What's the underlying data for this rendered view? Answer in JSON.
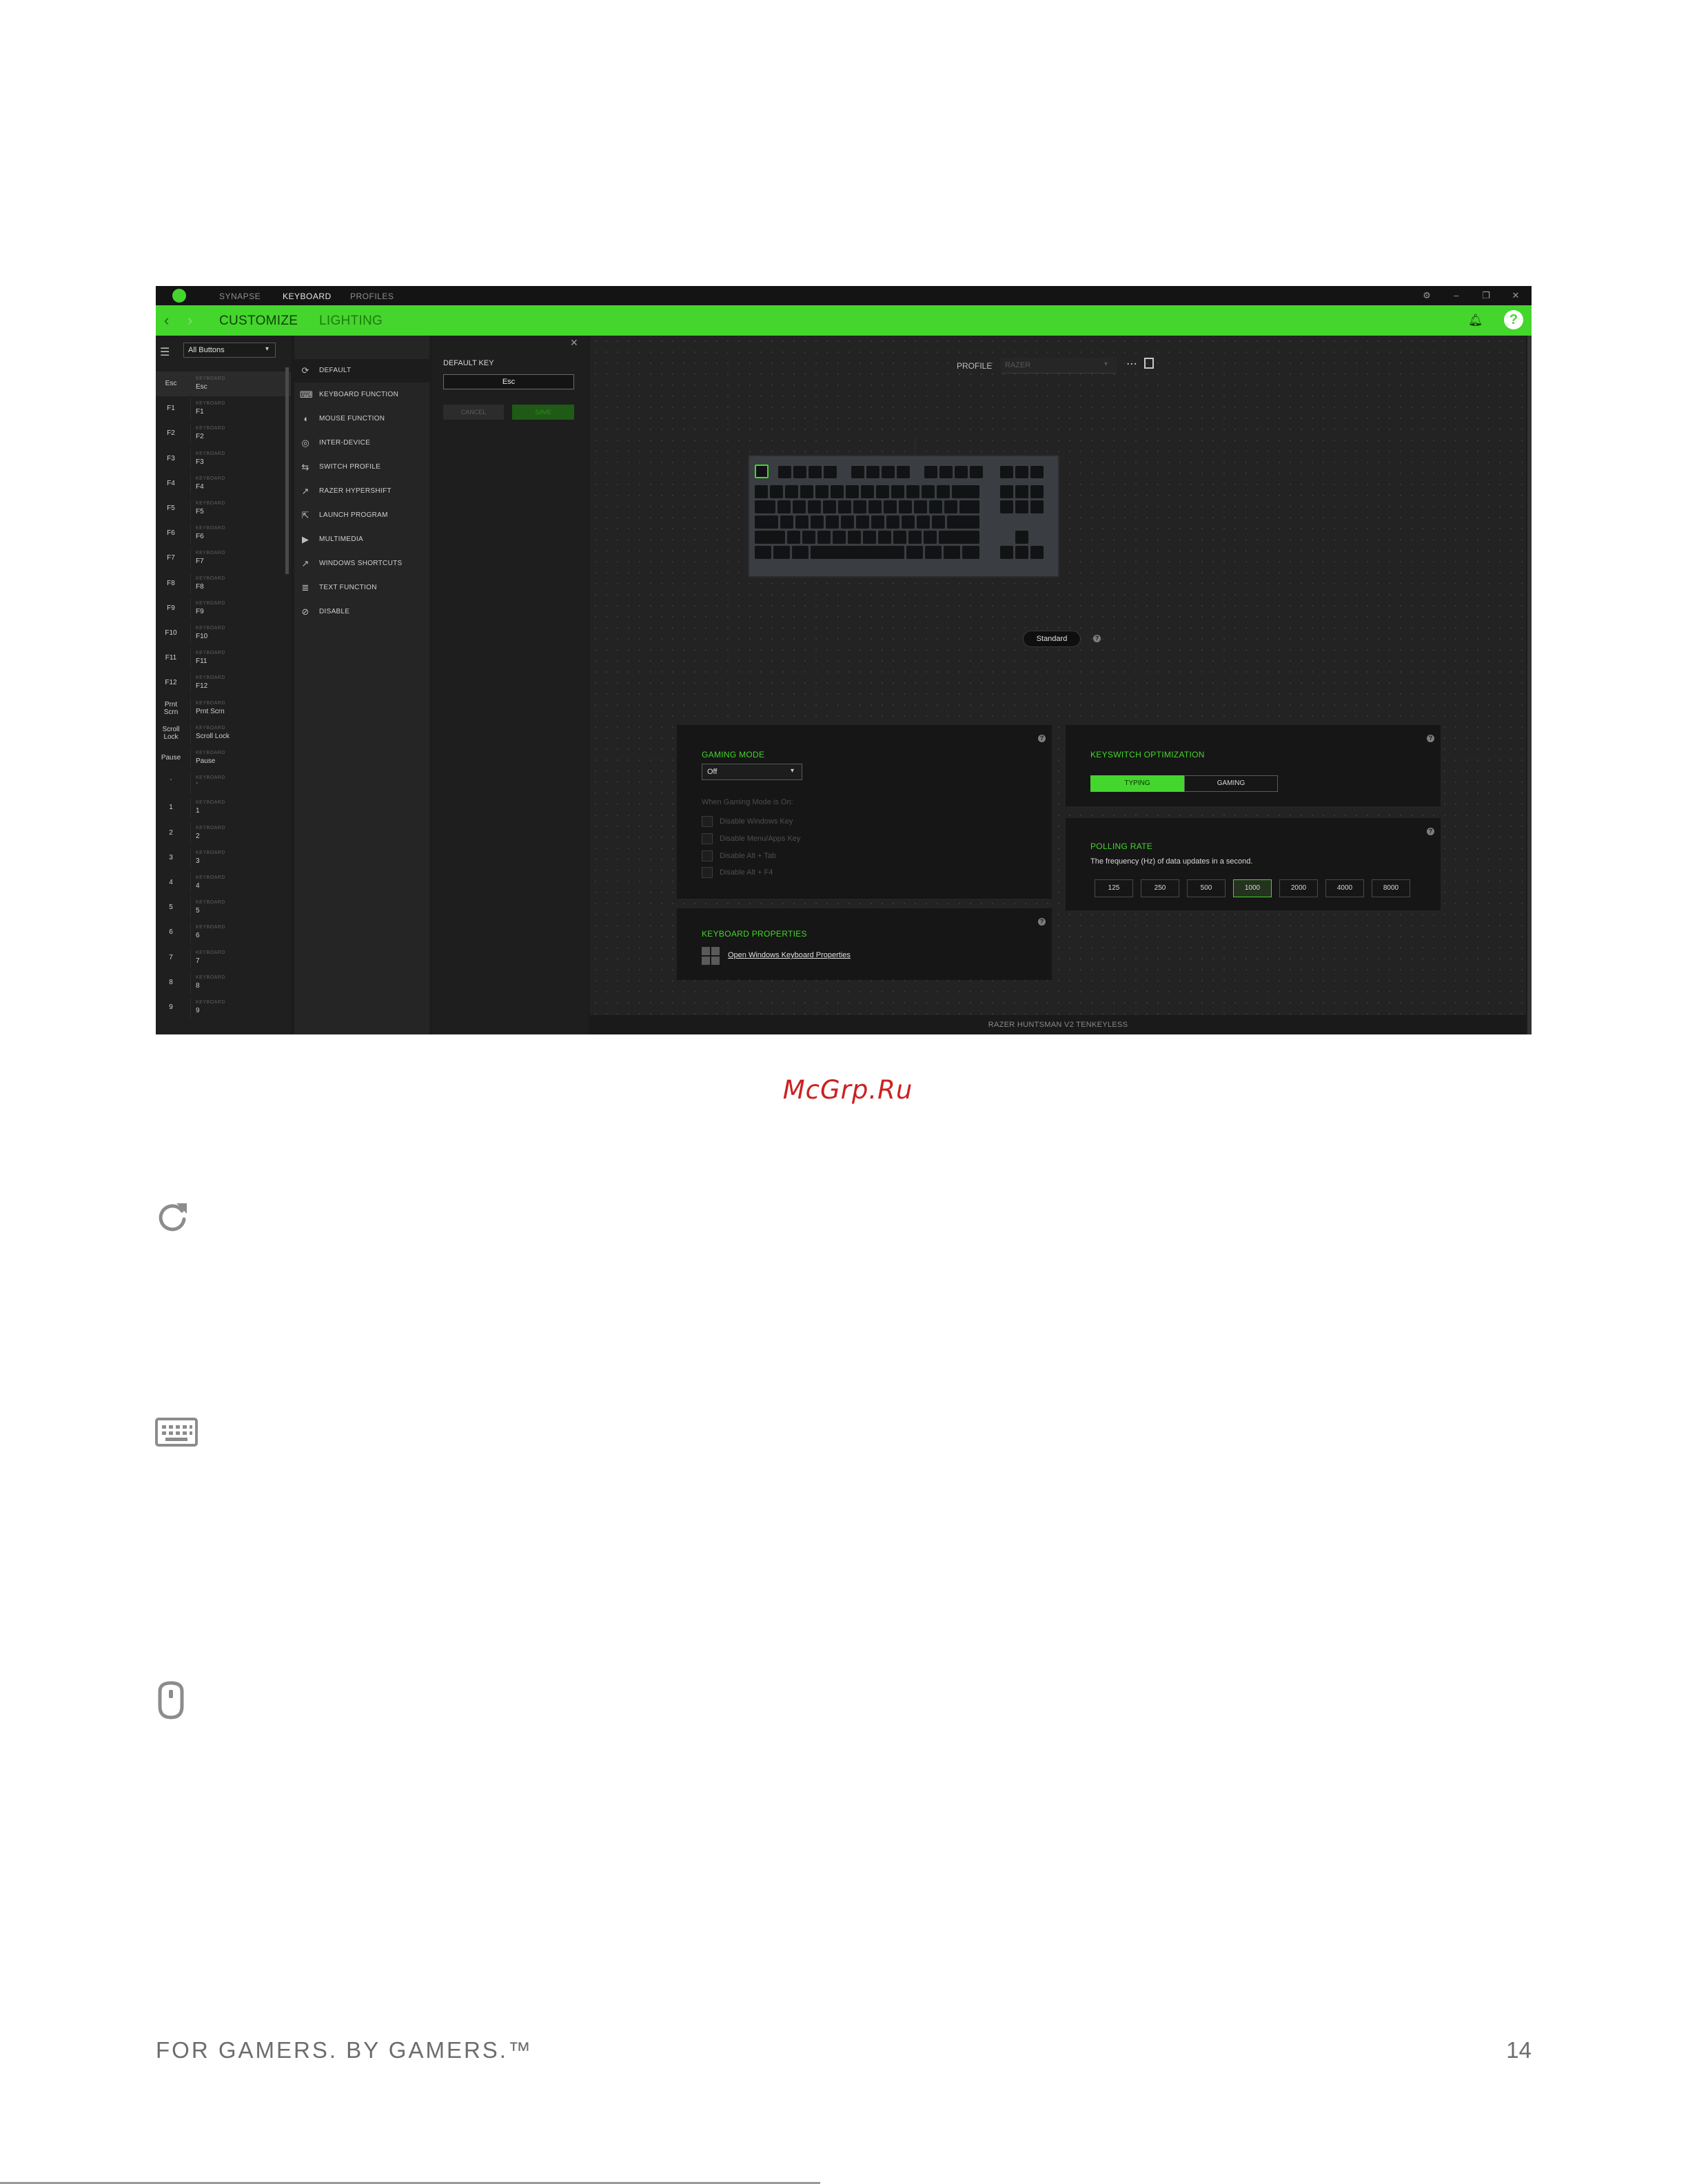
{
  "app": {
    "nav": [
      "SYNAPSE",
      "KEYBOARD",
      "PROFILES"
    ],
    "active_nav": "KEYBOARD",
    "tabs": [
      "CUSTOMIZE",
      "LIGHTING"
    ],
    "colors": {
      "accent": "#44d62c",
      "background": "#1c1c1c"
    }
  },
  "keylist": {
    "dropdown": "All Buttons",
    "category": "KEYBOARD",
    "rows": [
      {
        "key": "Esc",
        "value": "Esc"
      },
      {
        "key": "F1",
        "value": "F1"
      },
      {
        "key": "F2",
        "value": "F2"
      },
      {
        "key": "F3",
        "value": "F3"
      },
      {
        "key": "F4",
        "value": "F4"
      },
      {
        "key": "F5",
        "value": "F5"
      },
      {
        "key": "F6",
        "value": "F6"
      },
      {
        "key": "F7",
        "value": "F7"
      },
      {
        "key": "F8",
        "value": "F8"
      },
      {
        "key": "F9",
        "value": "F9"
      },
      {
        "key": "F10",
        "value": "F10"
      },
      {
        "key": "F11",
        "value": "F11"
      },
      {
        "key": "F12",
        "value": "F12"
      },
      {
        "key": "Prnt Scrn",
        "value": "Prnt Scrn"
      },
      {
        "key": "Scroll Lock",
        "value": "Scroll Lock"
      },
      {
        "key": "Pause",
        "value": "Pause"
      },
      {
        "key": "`",
        "value": "`"
      },
      {
        "key": "1",
        "value": "1"
      },
      {
        "key": "2",
        "value": "2"
      },
      {
        "key": "3",
        "value": "3"
      },
      {
        "key": "4",
        "value": "4"
      },
      {
        "key": "5",
        "value": "5"
      },
      {
        "key": "6",
        "value": "6"
      },
      {
        "key": "7",
        "value": "7"
      },
      {
        "key": "8",
        "value": "8"
      },
      {
        "key": "9",
        "value": "9"
      }
    ]
  },
  "functions": [
    {
      "label": "DEFAULT",
      "icon": "reset-icon"
    },
    {
      "label": "KEYBOARD FUNCTION",
      "icon": "keyboard-icon"
    },
    {
      "label": "MOUSE FUNCTION",
      "icon": "mouse-icon"
    },
    {
      "label": "INTER-DEVICE",
      "icon": "inter-device-icon"
    },
    {
      "label": "SWITCH PROFILE",
      "icon": "switch-icon"
    },
    {
      "label": "RAZER HYPERSHIFT",
      "icon": "hypershift-icon"
    },
    {
      "label": "LAUNCH PROGRAM",
      "icon": "launch-icon"
    },
    {
      "label": "MULTIMEDIA",
      "icon": "multimedia-icon"
    },
    {
      "label": "WINDOWS SHORTCUTS",
      "icon": "shortcut-icon"
    },
    {
      "label": "TEXT FUNCTION",
      "icon": "text-icon"
    },
    {
      "label": "DISABLE",
      "icon": "disable-icon"
    }
  ],
  "default_panel": {
    "title": "DEFAULT KEY",
    "value": "Esc",
    "cancel": "CANCEL",
    "save": "SAVE"
  },
  "profile": {
    "label": "PROFILE",
    "value": "RAZER"
  },
  "mode_pill": "Standard",
  "gaming_mode": {
    "title": "GAMING MODE",
    "value": "Off",
    "subtitle": "When Gaming Mode is On:",
    "options": [
      "Disable Windows Key",
      "Disable Menu/Apps Key",
      "Disable Alt + Tab",
      "Disable Alt + F4"
    ]
  },
  "keyswitch": {
    "title": "KEYSWITCH OPTIMIZATION",
    "options": [
      "TYPING",
      "GAMING"
    ],
    "selected": "TYPING"
  },
  "polling": {
    "title": "POLLING RATE",
    "description": "The frequency (Hz) of data updates in a second.",
    "rates": [
      "125",
      "250",
      "500",
      "1000",
      "2000",
      "4000",
      "8000"
    ],
    "selected": "1000"
  },
  "keyboard_props": {
    "title": "KEYBOARD PROPERTIES",
    "link": "Open Windows Keyboard Properties"
  },
  "device_name": "RAZER HUNTSMAN V2 TENKEYLESS",
  "page": {
    "watermark": "McGrp.Ru",
    "footer_left": "FOR GAMERS. BY GAMERS.™",
    "page_number": "14"
  }
}
